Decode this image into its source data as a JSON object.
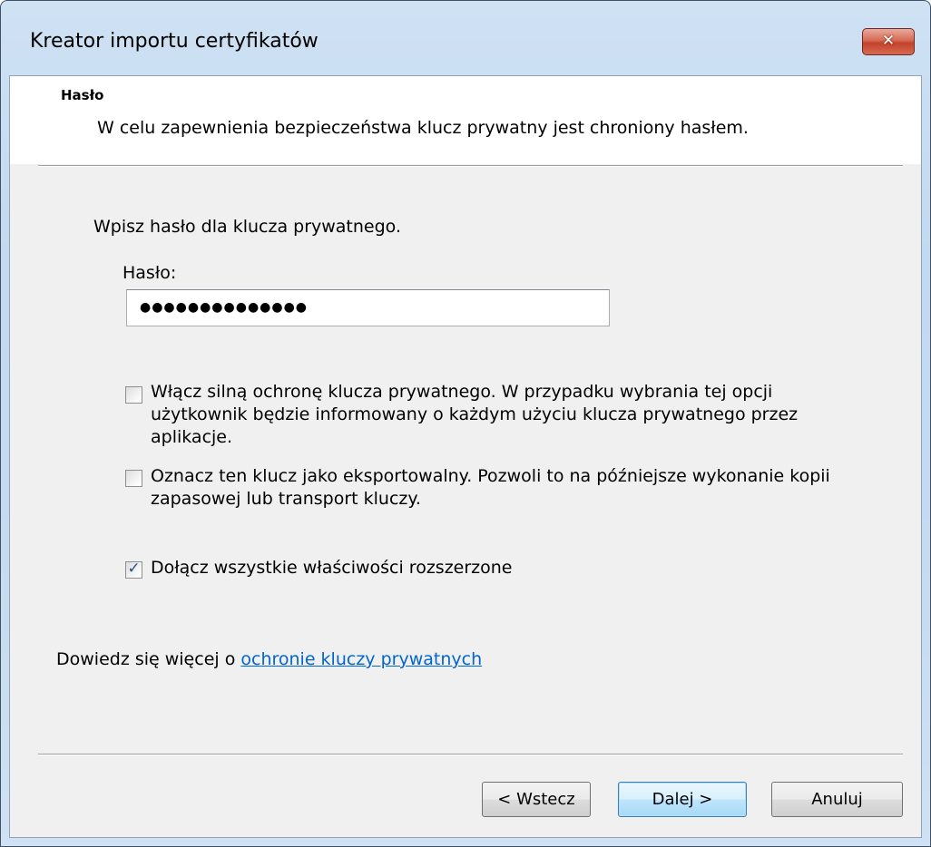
{
  "window": {
    "title": "Kreator importu certyfikatów",
    "close_glyph": "✕"
  },
  "header": {
    "title": "Hasło",
    "description": "W celu zapewnienia bezpieczeństwa klucz prywatny jest chroniony hasłem."
  },
  "form": {
    "prompt": "Wpisz hasło dla klucza prywatnego.",
    "password_label": "Hasło:",
    "password_value": "●●●●●●●●●●●●●●"
  },
  "options": [
    {
      "label": "Włącz silną ochronę klucza prywatnego. W przypadku wybrania tej opcji\nużytkownik będzie informowany o każdym użyciu klucza prywatnego przez\naplikacje.",
      "checked": false,
      "check_glyph": ""
    },
    {
      "label": "Oznacz ten klucz jako eksportowalny. Pozwoli to na późniejsze wykonanie kopii\nzapasowej lub transport kluczy.",
      "checked": false,
      "check_glyph": ""
    },
    {
      "label": "Dołącz wszystkie właściwości rozszerzone",
      "checked": true,
      "check_glyph": "✓"
    }
  ],
  "learn_more": {
    "prefix": "Dowiedz się więcej o ",
    "link": "ochronie kluczy prywatnych"
  },
  "buttons": {
    "back": "< Wstecz",
    "next": "Dalej >",
    "cancel": "Anuluj"
  },
  "colors": {
    "link": "#0066cc",
    "title_bar": "#c3d9ef",
    "close_button": "#c3422b",
    "checkmark": "#2b4f8a"
  }
}
